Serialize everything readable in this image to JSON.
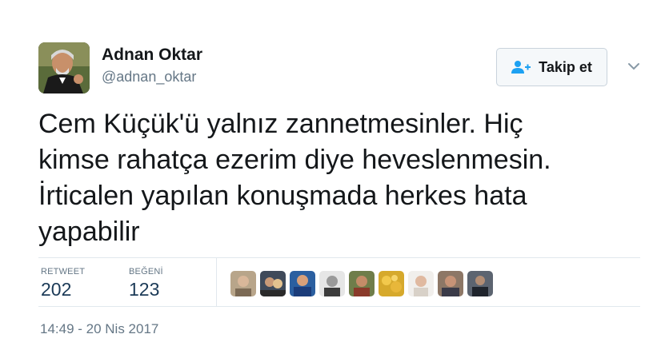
{
  "user": {
    "name": "Adnan Oktar",
    "handle": "@adnan_oktar"
  },
  "follow_button": {
    "label": "Takip et",
    "icon": "add-user-icon"
  },
  "menu_icon": "chevron-down-icon",
  "tweet": {
    "lines": [
      "Cem Küçük'ü yalnız zannetmesinler. Hiç",
      "kimse rahatça ezerim diye heveslenmesin.",
      "İrticalen yapılan konuşmada herkes hata",
      "yapabilir"
    ]
  },
  "stats": {
    "retweet_label": "RETWEET",
    "retweet_count": "202",
    "like_label": "BEĞENİ",
    "like_count": "123"
  },
  "liker_avatars_count": 9,
  "timestamp": "14:49 - 20 Nis 2017",
  "colors": {
    "text": "#14171a",
    "secondary": "#657786",
    "accent_blue": "#1da1f2",
    "border": "#e1e8ed"
  }
}
